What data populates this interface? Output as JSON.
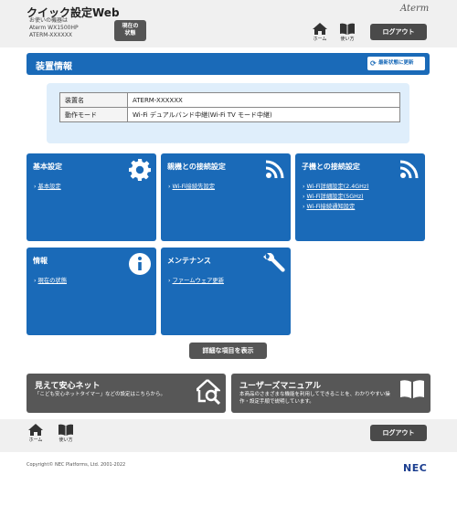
{
  "header": {
    "title": "クイック設定Web",
    "device_caption": "お使いの機器は",
    "device_model": "Aterm WX1500HP",
    "device_name": "ATERM-XXXXXX",
    "status_button": "現在の\n状態",
    "brand": "Aterm",
    "home_label": "ホーム",
    "help_label": "使い方",
    "logout_label": "ログアウト"
  },
  "section": {
    "title": "装置情報",
    "refresh_label": "最新状態に更新"
  },
  "device_table": [
    {
      "key": "装置名",
      "value": "ATERM-XXXXXX"
    },
    {
      "key": "動作モード",
      "value": "Wi-Fi デュアルバンド中継(Wi-Fi TV モード中継)"
    }
  ],
  "tiles": [
    {
      "title": "基本設定",
      "icon": "gear-icon",
      "links": [
        "基本設定"
      ]
    },
    {
      "title": "親機との接続設定",
      "icon": "wifi-icon",
      "links": [
        "Wi-Fi接続先設定"
      ]
    },
    {
      "title": "子機との接続設定",
      "icon": "wifi-icon",
      "links": [
        "Wi-Fi詳細設定(2.4GHz)",
        "Wi-Fi詳細設定(5GHz)",
        "Wi-Fi接続通知設定"
      ]
    },
    {
      "title": "情報",
      "icon": "info-icon",
      "links": [
        "現在の状態"
      ]
    },
    {
      "title": "メンテナンス",
      "icon": "wrench-icon",
      "links": [
        "ファームウェア更新"
      ]
    }
  ],
  "detail_button": "詳細な項目を表示",
  "promo": {
    "safety_title": "見えて安心ネット",
    "safety_text": "「こども安心ネットタイマー」などの設定はこちらから。",
    "manual_title": "ユーザーズマニュアル",
    "manual_text": "本商品のさまざまな機能を利用してできることを、わかりやすい操作・設定手順で説明しています。"
  },
  "footer": {
    "home_label": "ホーム",
    "help_label": "使い方",
    "logout_label": "ログアウト",
    "copyright": "Copyright© NEC Platforms, Ltd. 2001-2022",
    "nec_logo": "NEC"
  },
  "colors": {
    "accent": "#1a6ab8",
    "dark": "#575757"
  }
}
